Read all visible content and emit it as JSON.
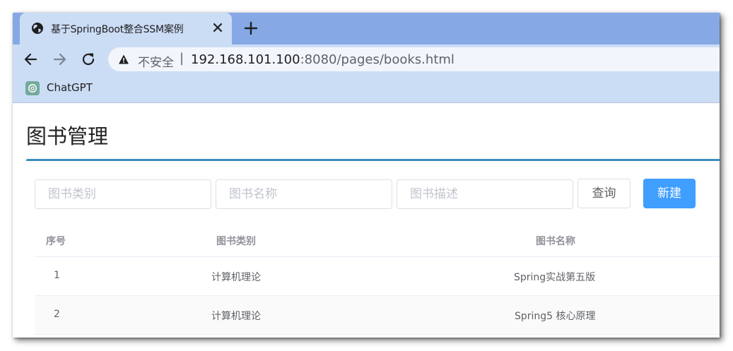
{
  "browser": {
    "tab": {
      "title": "基于SpringBoot整合SSM案例"
    },
    "address_bar": {
      "security_label": "不安全",
      "separator": "|",
      "url_host": "192.168.101.100",
      "url_rest": ":8080/pages/books.html"
    },
    "bookmarks": [
      {
        "label": "ChatGPT"
      }
    ]
  },
  "page": {
    "title": "图书管理",
    "accent_color": "#3c8dbc",
    "filters": {
      "type_placeholder": "图书类别",
      "name_placeholder": "图书名称",
      "description_placeholder": "图书描述"
    },
    "buttons": {
      "query": "查询",
      "new": "新建"
    },
    "table": {
      "headers": {
        "index": "序号",
        "type": "图书类别",
        "name": "图书名称"
      },
      "rows": [
        {
          "index": "1",
          "type": "计算机理论",
          "name": "Spring实战第五版"
        },
        {
          "index": "2",
          "type": "计算机理论",
          "name": "Spring5 核心原理"
        }
      ]
    }
  }
}
